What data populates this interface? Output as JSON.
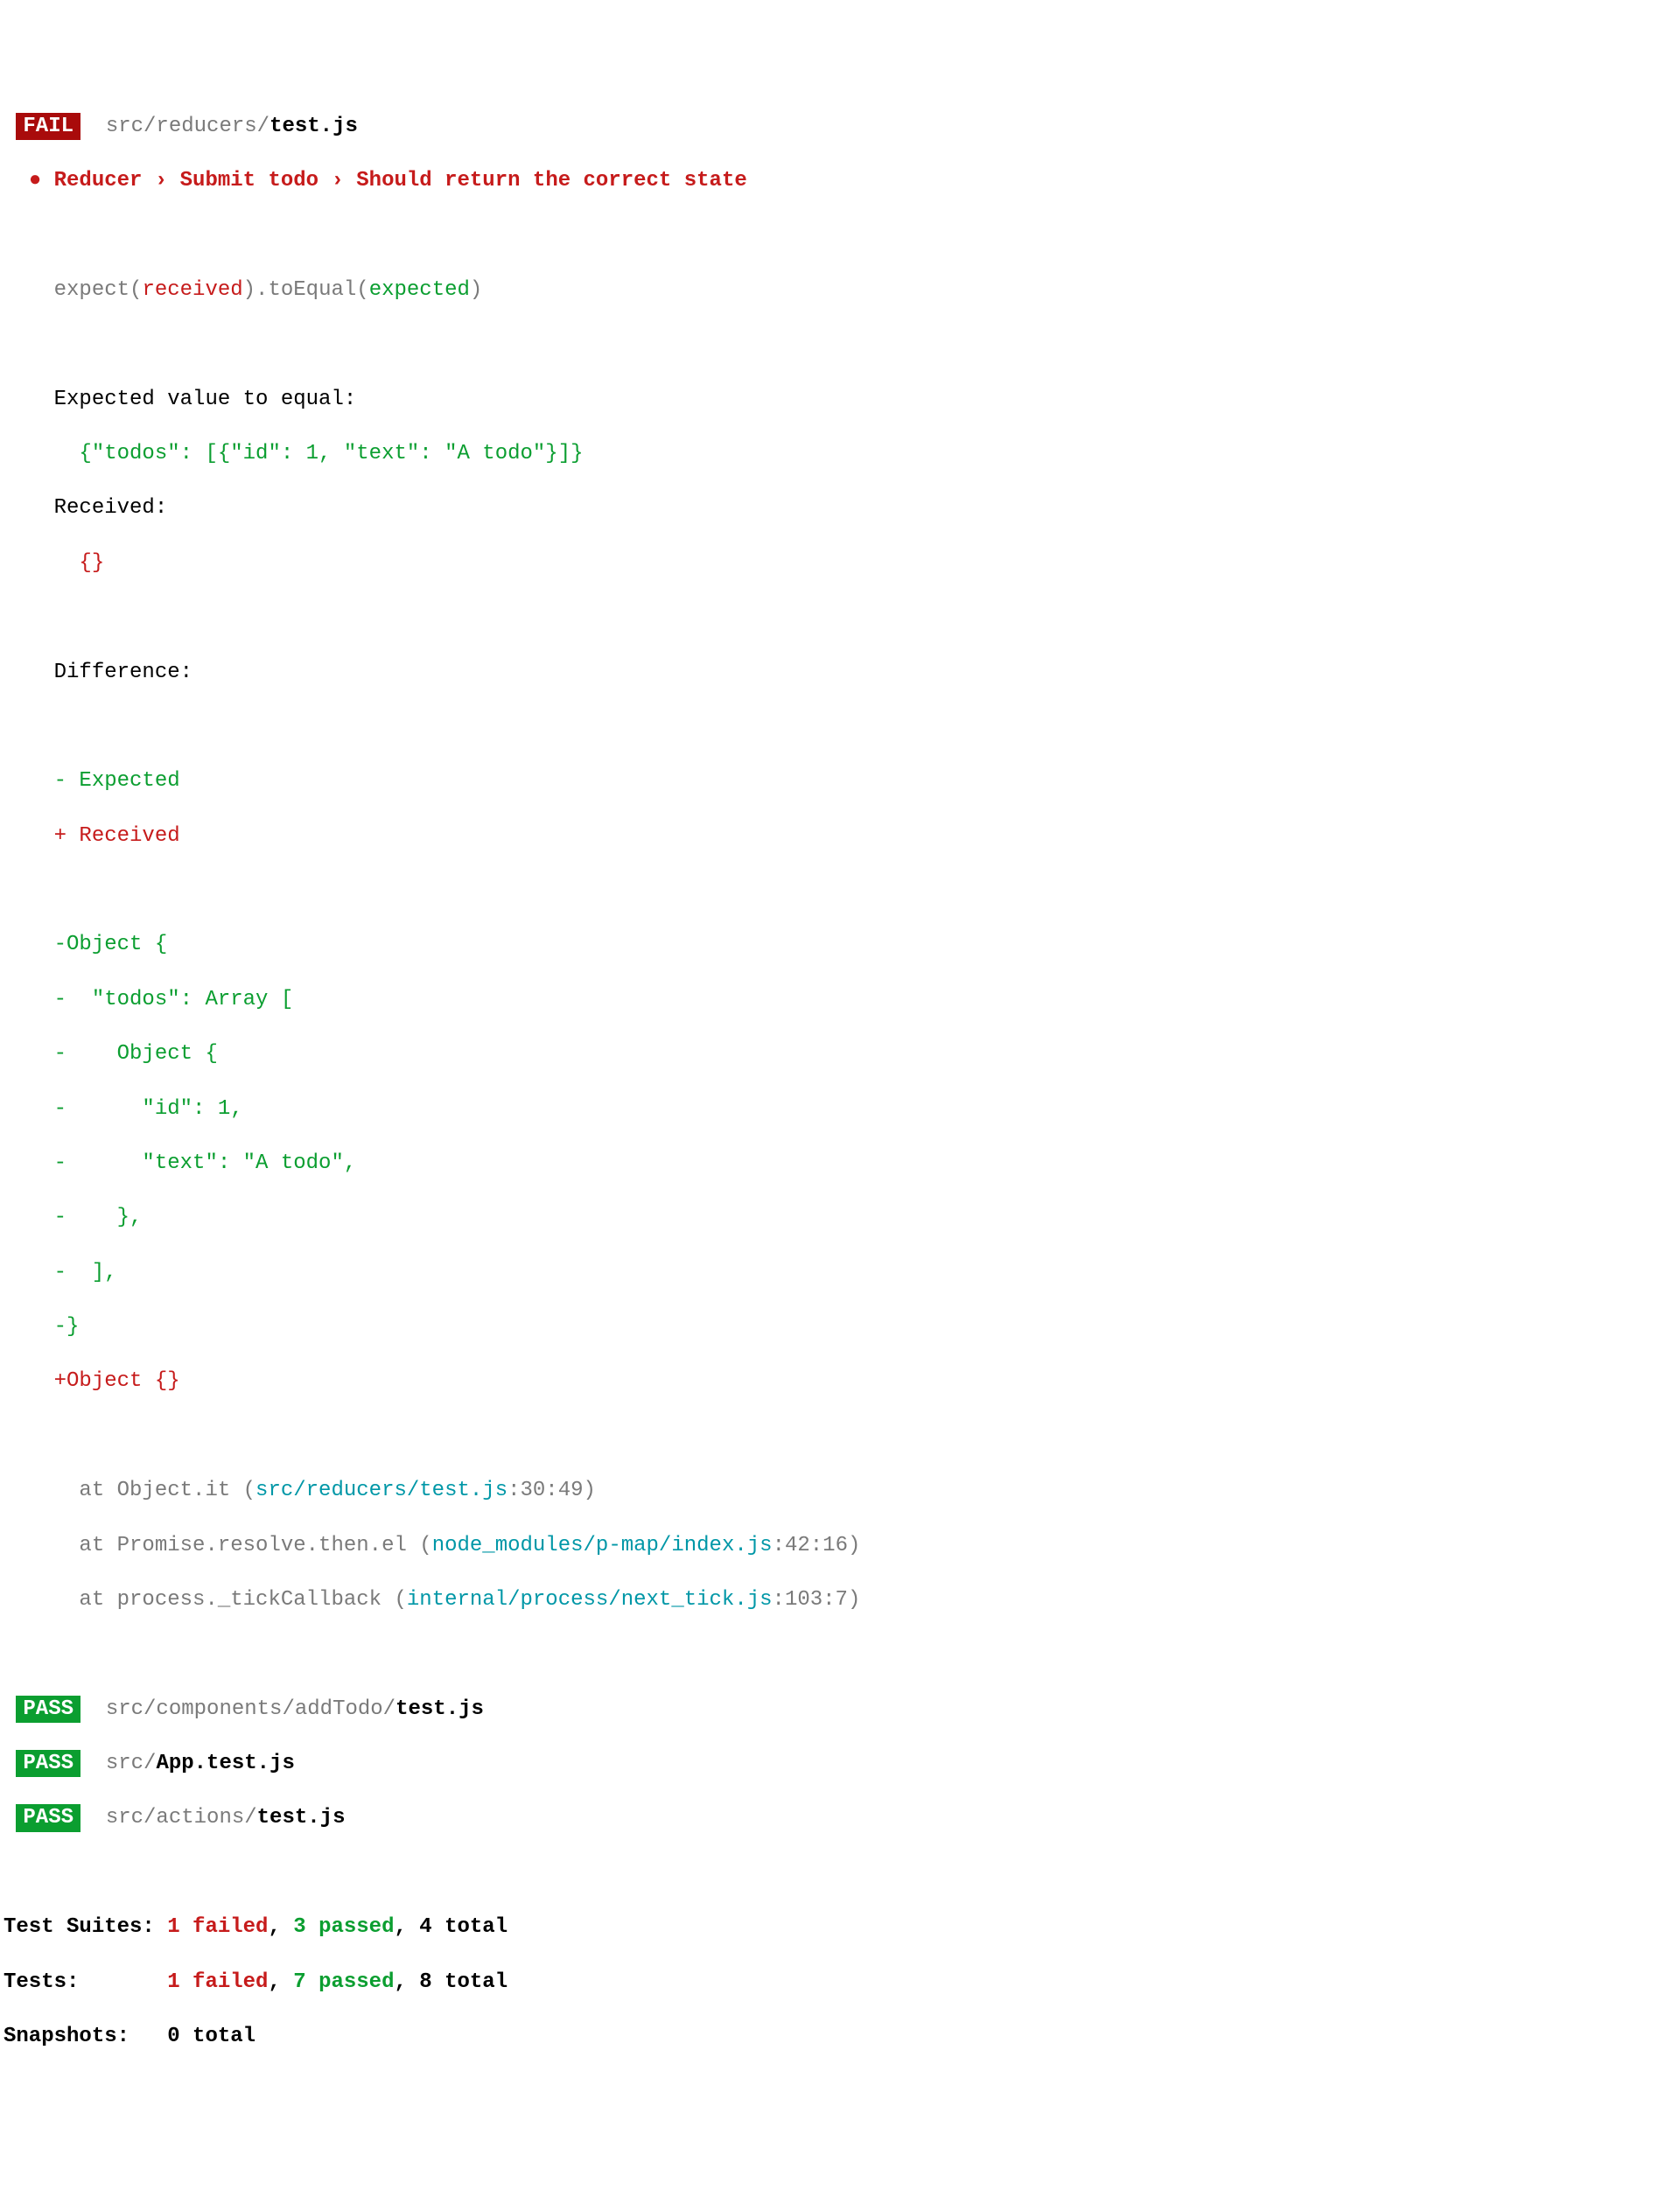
{
  "header": {
    "fail_badge": "FAIL",
    "file_path_dim": " src/reducers/",
    "file_path_bold": "test.js"
  },
  "test_name": {
    "bullet": "●",
    "text": " Reducer › Submit todo › Should return the correct state"
  },
  "expect_line": {
    "p1": "expect(",
    "received": "received",
    "p2": ").toEqual(",
    "expected": "expected",
    "p3": ")"
  },
  "expected_label": "Expected value to equal:",
  "expected_value": "  {\"todos\": [{\"id\": 1, \"text\": \"A todo\"}]}",
  "received_label": "Received:",
  "received_value": "  {}",
  "difference_label": "Difference:",
  "diff_legend": {
    "expected": "- Expected",
    "received": "+ Received"
  },
  "diff_lines": {
    "l1": "-Object {",
    "l2": "-  \"todos\": Array [",
    "l3": "-    Object {",
    "l4": "-      \"id\": 1,",
    "l5": "-      \"text\": \"A todo\",",
    "l6": "-    },",
    "l7": "-  ],",
    "l8": "-}",
    "l9": "+Object {}"
  },
  "stack": {
    "s1a": "  at Object.it (",
    "s1b": "src/reducers/test.js",
    "s1c": ":30:49)",
    "s2a": "  at Promise.resolve.then.el (",
    "s2b": "node_modules/p-map/index.js",
    "s2c": ":42:16)",
    "s3a": "  at process._tickCallback (",
    "s3b": "internal/process/next_tick.js",
    "s3c": ":103:7)"
  },
  "pass_rows": {
    "badge": "PASS",
    "r1_dim": " src/components/addTodo/",
    "r1_bold": "test.js",
    "r2_dim": " src/",
    "r2_bold": "App.test.js",
    "r3_dim": " src/actions/",
    "r3_bold": "test.js"
  },
  "summary": {
    "suites_label": "Test Suites: ",
    "suites_failed": "1 failed",
    "suites_passed": "3 passed",
    "suites_total": ", 4 total",
    "tests_label": "Tests:       ",
    "tests_failed": "1 failed",
    "tests_passed": "7 passed",
    "tests_total": ", 8 total",
    "snapshots_label": "Snapshots:   ",
    "snapshots_value": "0 total"
  },
  "sep": ", "
}
